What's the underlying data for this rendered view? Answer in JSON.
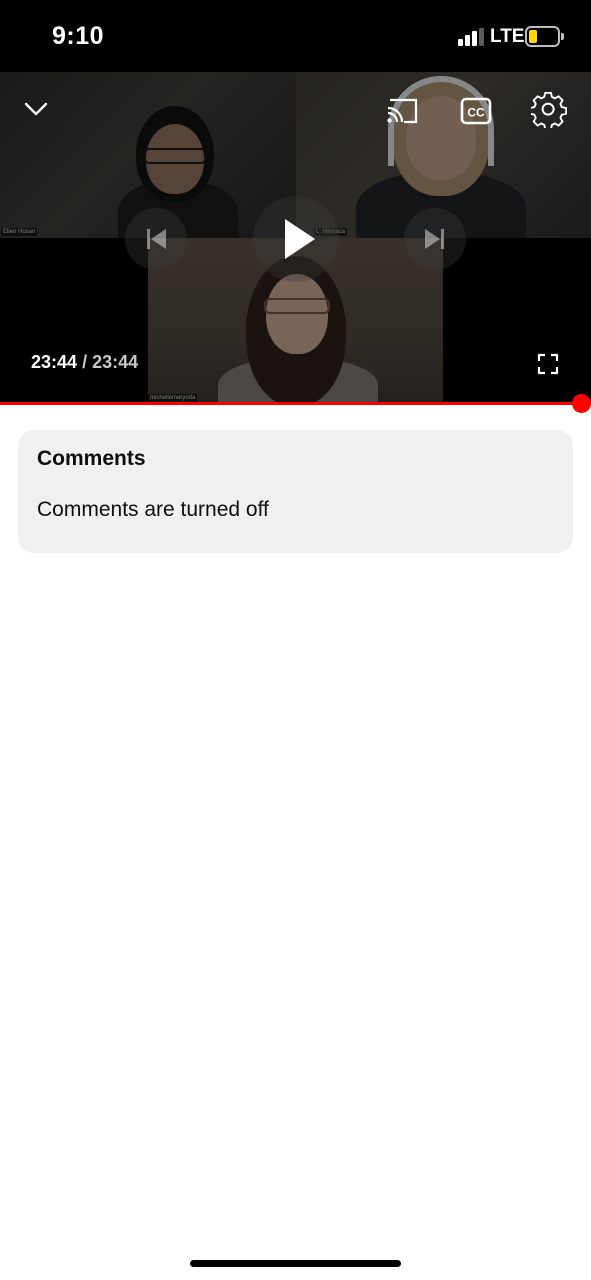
{
  "status_bar": {
    "time": "9:10",
    "network": "LTE",
    "signal_bars": 3,
    "battery_level": 0.3,
    "battery_color": "#ffd60a"
  },
  "player": {
    "participants": [
      {
        "name": "Ellen Hosan"
      },
      {
        "name": "L. Hamaca"
      },
      {
        "name": "michellemaryoda"
      }
    ],
    "elapsed": "23:44",
    "separator": "/",
    "duration": "23:44",
    "progress": 1.0,
    "accent_color": "#ff0000",
    "controls": {
      "collapse_icon": "chevron-down-icon",
      "cast_icon": "cast-icon",
      "captions_icon": "closed-captions-icon",
      "captions_label": "CC",
      "settings_icon": "gear-icon",
      "previous_icon": "skip-previous-icon",
      "play_icon": "play-icon",
      "next_icon": "skip-next-icon",
      "fullscreen_icon": "fullscreen-icon"
    }
  },
  "comments": {
    "title": "Comments",
    "message": "Comments are turned off"
  }
}
